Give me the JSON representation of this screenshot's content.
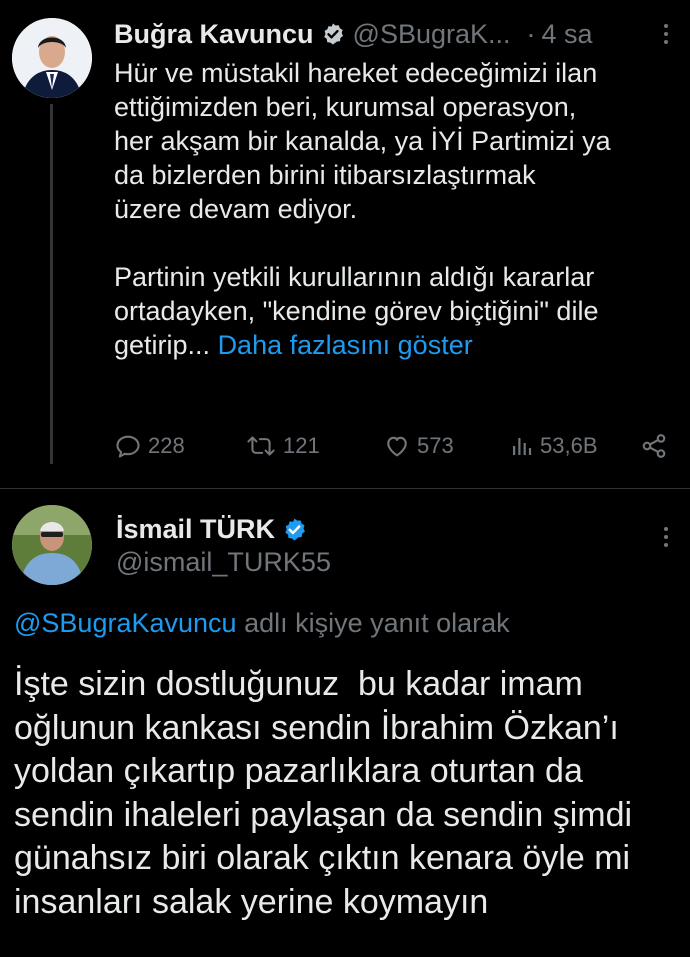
{
  "tweet": {
    "author_name": "Buğra Kavuncu",
    "handle": "@SBugraK...",
    "separator": "·",
    "time": "4 sa",
    "text_p1_lines": [
      "Hür ve müstakil hareket edeceğimizi ilan",
      "ettiğimizden beri, kurumsal operasyon,",
      "her akşam bir kanalda, ya İYİ Partimizi ya",
      "da bizlerden birini itibarsızlaştırmak",
      "üzere devam ediyor."
    ],
    "text_p2_lines": [
      "Partinin yetkili kurullarının aldığı kararlar",
      "ortadayken, \"kendine görev biçtiğini\" dile"
    ],
    "text_p2_last": "getirip...",
    "show_more": "Daha fazlasını göster",
    "stats": {
      "replies": "228",
      "retweets": "121",
      "likes": "573",
      "views": "53,6B"
    }
  },
  "reply": {
    "author_name": "İsmail TÜRK",
    "handle": "@ismail_TURK55",
    "replying_to_handle": "@SBugraKavuncu",
    "replying_to_suffix": "adlı kişiye yanıt olarak",
    "text_lines": [
      "İşte sizin dostluğunuz  bu kadar imam",
      "oğlunun kankası sendin İbrahim Özkan’ı",
      "yoldan çıkartıp pazarlıklara oturtan da",
      "sendin ihaleleri paylaşan da sendin şimdi",
      "günahsız biri olarak çıktın kenara öyle mi",
      "insanları salak yerine koymayın"
    ]
  },
  "icons": [
    "verified-badge-icon",
    "more-icon",
    "reply-icon",
    "retweet-icon",
    "like-icon",
    "views-icon",
    "share-icon"
  ],
  "colors": {
    "background": "#000000",
    "text": "#e7e9ea",
    "muted": "#71767b",
    "link": "#1d9bf0",
    "verified": "#1d9bf0"
  }
}
